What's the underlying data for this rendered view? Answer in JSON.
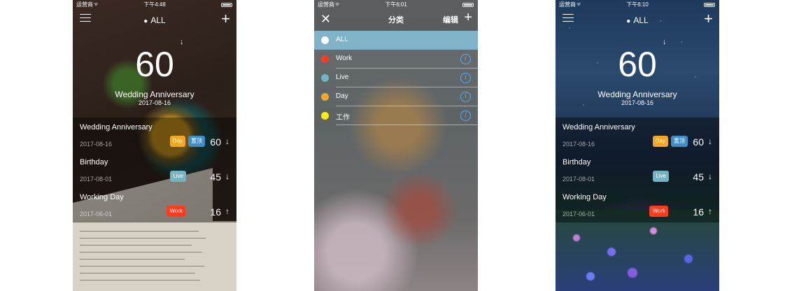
{
  "status": {
    "carrier": "运营商",
    "wifi": "ᯤ"
  },
  "screen1": {
    "time": "下午4:48",
    "header_title": "ALL",
    "header_tag_icon": "tag-icon",
    "hero": {
      "days": "60",
      "name": "Wedding Anniversary",
      "date": "2017-08-16",
      "arrow": "↓"
    },
    "events": [
      {
        "name": "Wedding Anniversary",
        "date": "2017-08-16",
        "badge": "Day",
        "pin": "置顶",
        "days": "60",
        "arrow": "↓"
      },
      {
        "name": "Birthday",
        "date": "2017-08-01",
        "badge": "Live",
        "days": "45",
        "arrow": "↓"
      },
      {
        "name": "Working Day",
        "date": "2017-06-01",
        "badge": "Work",
        "days": "16",
        "arrow": "↑"
      }
    ]
  },
  "screen2": {
    "time": "下午6:01",
    "title": "分类",
    "edit_label": "编辑",
    "close_icon": "close-icon",
    "categories": [
      {
        "label": "ALL",
        "color": "#ffffff",
        "selected": true
      },
      {
        "label": "Work",
        "color": "#ff3b1e"
      },
      {
        "label": "Live",
        "color": "#72b4c2"
      },
      {
        "label": "Day",
        "color": "#f5a623"
      },
      {
        "label": "工作",
        "color": "#ffee00"
      }
    ]
  },
  "screen3": {
    "time": "下午6:10",
    "header_title": "ALL",
    "hero": {
      "days": "60",
      "name": "Wedding Anniversary",
      "date": "2017-08-16",
      "arrow": "↓"
    },
    "events": [
      {
        "name": "Wedding Anniversary",
        "date": "2017-08-16",
        "badge": "Day",
        "pin": "置顶",
        "days": "60",
        "arrow": "↓"
      },
      {
        "name": "Birthday",
        "date": "2017-08-01",
        "badge": "Live",
        "days": "45",
        "arrow": "↓"
      },
      {
        "name": "Working Day",
        "date": "2017-06-01",
        "badge": "Work",
        "days": "16",
        "arrow": "↑"
      }
    ]
  },
  "colors": {
    "day": "#f5a623",
    "pin": "#3a8fc8",
    "live": "#72b4c2",
    "work": "#ff3b1e",
    "selected_row": "#7fb3c8",
    "info": "#5aa9f0"
  }
}
